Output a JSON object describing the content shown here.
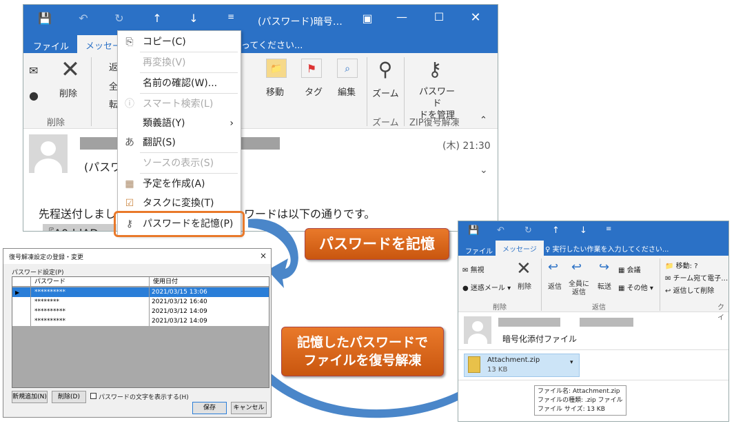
{
  "main": {
    "title": "(パスワード)暗号…",
    "tabs": [
      "ファイル",
      "メッセージ"
    ],
    "tellme": "ってください...",
    "ribbon": {
      "delete_label": "削除",
      "group_delete": "削除",
      "move": "移動",
      "tag": "タグ",
      "edit": "編集",
      "zoom": "ズーム",
      "group_zoom": "ズーム",
      "password": "パスワード\nドを管理",
      "group_zip": "ZIP復号解凍",
      "reply_partial": [
        "返",
        "全",
        "転"
      ]
    },
    "time": "(木) 21:30",
    "subject": "(パスワ",
    "body_line1a": "先程送付しまし",
    "body_line1b": "ワードは以下の通りです。",
    "body_line2": "『A0ddADww"
  },
  "context_menu": [
    {
      "label": "コピー(C)",
      "icon": "copy-icon",
      "glyph": "⎘",
      "disabled": false
    },
    {
      "label": "再変換(V)",
      "icon": "",
      "glyph": "",
      "disabled": true
    },
    {
      "label": "名前の確認(W)...",
      "icon": "",
      "glyph": "",
      "disabled": false
    },
    {
      "label": "スマート検索(L)",
      "icon": "info-icon",
      "glyph": "ⓘ",
      "disabled": true
    },
    {
      "label": "類義語(Y)",
      "icon": "",
      "glyph": "",
      "disabled": false,
      "sub": "›"
    },
    {
      "label": "翻訳(S)",
      "icon": "translate-icon",
      "glyph": "あ",
      "disabled": false
    },
    {
      "label": "ソースの表示(S)",
      "icon": "",
      "glyph": "",
      "disabled": true
    },
    {
      "label": "予定を作成(A)",
      "icon": "calendar-icon",
      "glyph": "▦",
      "disabled": false
    },
    {
      "label": "タスクに変換(T)",
      "icon": "task-icon",
      "glyph": "☑",
      "disabled": false
    },
    {
      "label": "パスワードを記憶(P)",
      "icon": "key-icon",
      "glyph": "⚷",
      "disabled": false
    }
  ],
  "callout1": "パスワードを記憶",
  "callout2": [
    "記憶したパスワードで",
    "ファイルを復号解凍"
  ],
  "dialog": {
    "title": "復号解凍設定の登録・変更",
    "close": "×",
    "section": "パスワード設定(P)",
    "headers": [
      "パスワード",
      "使用日付"
    ],
    "rows": [
      [
        "**********",
        "2021/03/15 13:06"
      ],
      [
        "********",
        "2021/03/12 16:40"
      ],
      [
        "**********",
        "2021/03/12 14:09"
      ],
      [
        "**********",
        "2021/03/12 14:09"
      ]
    ],
    "btn_add": "新規追加(N)",
    "btn_del": "削除(D)",
    "checkbox": "パスワードの文字を表示する(H)",
    "btn_save": "保存",
    "btn_cancel": "キャンセル"
  },
  "second": {
    "tabs": [
      "ファイル",
      "メッセージ"
    ],
    "tellme": "♀ 実行したい作業を入力してください...",
    "ignore": "無視",
    "junk": "迷惑メール ▾",
    "delete": "削除",
    "group_delete": "削除",
    "reply": "返信",
    "reply_all": "全員に\n返信",
    "forward": "転送",
    "meeting": "会議",
    "other": "その他 ▾",
    "group_reply": "返信",
    "move_to": "移動: ?",
    "team": "チーム宛て電子…",
    "reply_delete": "返信して削除",
    "group_quick": "クイ",
    "subject": "暗号化添付ファイル",
    "attachment_name": "Attachment.zip",
    "attachment_size": "13 KB",
    "tooltip": [
      "ファイル名:  Attachment.zip",
      "ファイルの種類:  .zip ファイル",
      "ファイル サイズ:  13 KB"
    ]
  }
}
